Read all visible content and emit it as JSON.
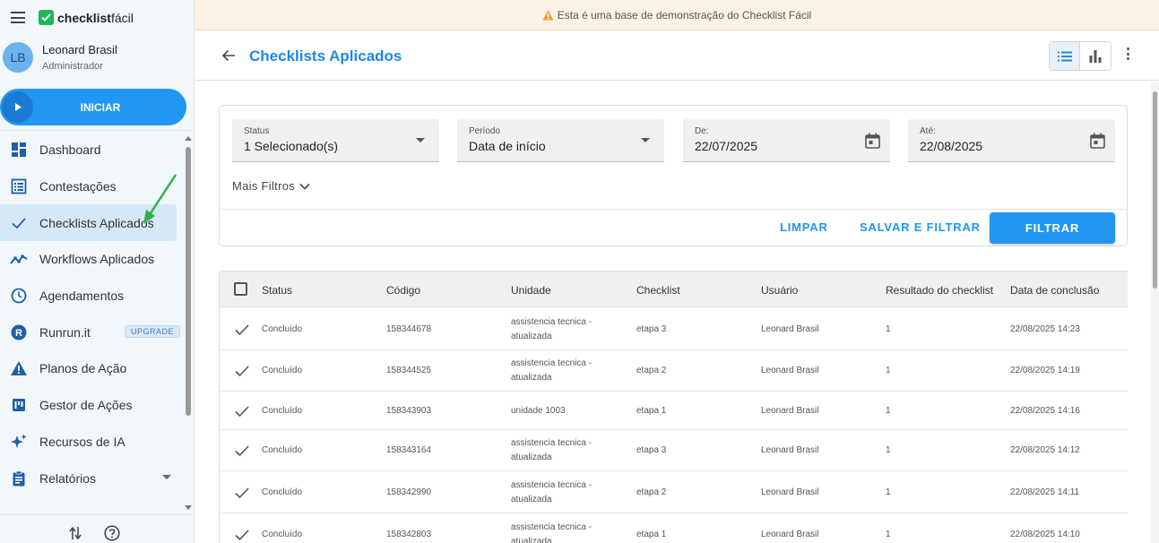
{
  "sidebar": {
    "logo_bold": "checklist",
    "logo_light": "fácil",
    "user_initials": "LB",
    "user_name": "Leonard Brasil",
    "user_role": "Administrador",
    "start_label": "INICIAR",
    "items": [
      {
        "label": "Dashboard",
        "icon": "dashboard-icon"
      },
      {
        "label": "Contestações",
        "icon": "list-icon"
      },
      {
        "label": "Checklists Aplicados",
        "icon": "check-icon"
      },
      {
        "label": "Workflows Aplicados",
        "icon": "trend-icon"
      },
      {
        "label": "Agendamentos",
        "icon": "clock-icon"
      },
      {
        "label": "Runrun.it",
        "icon": "runrun-icon",
        "badge": "UPGRADE"
      },
      {
        "label": "Planos de Ação",
        "icon": "warning-icon"
      },
      {
        "label": "Gestor de Ações",
        "icon": "kanban-icon"
      },
      {
        "label": "Recursos de IA",
        "icon": "sparkle-icon"
      },
      {
        "label": "Relatórios",
        "icon": "report-icon"
      }
    ]
  },
  "banner": {
    "text": "Esta é uma base de demonstração do Checklist Fácil"
  },
  "header": {
    "title": "Checklists Aplicados"
  },
  "filters": {
    "status_label": "Status",
    "status_value": "1 Selecionado(s)",
    "periodo_label": "Período",
    "periodo_value": "Data de início",
    "de_label": "De:",
    "de_value": "22/07/2025",
    "ate_label": "Até:",
    "ate_value": "22/08/2025",
    "more_label": "Mais Filtros",
    "clear_label": "LIMPAR",
    "save_label": "SALVAR E FILTRAR",
    "filter_label": "FILTRAR"
  },
  "table": {
    "headers": [
      "Status",
      "Código",
      "Unidade",
      "Checklist",
      "Usuário",
      "Resultado do checklist",
      "Data de conclusão"
    ],
    "rows": [
      {
        "status": "Concluído",
        "code": "158344678",
        "unit1": "assistencia tecnica -",
        "unit2": "atualizada",
        "checklist": "etapa 3",
        "user": "Leonard Brasil",
        "result": "1",
        "date": "22/08/2025 14:23"
      },
      {
        "status": "Concluído",
        "code": "158344525",
        "unit1": "assistencia tecnica -",
        "unit2": "atualizada",
        "checklist": "etapa 2",
        "user": "Leonard Brasil",
        "result": "1",
        "date": "22/08/2025 14:19"
      },
      {
        "status": "Concluído",
        "code": "158343903",
        "unit1": "unidade 1003",
        "unit2": "",
        "checklist": "etapa 1",
        "user": "Leonard Brasil",
        "result": "1",
        "date": "22/08/2025 14:16"
      },
      {
        "status": "Concluído",
        "code": "158343164",
        "unit1": "assistencia tecnica -",
        "unit2": "atualizada",
        "checklist": "etapa 3",
        "user": "Leonard Brasil",
        "result": "1",
        "date": "22/08/2025 14:12"
      },
      {
        "status": "Concluído",
        "code": "158342990",
        "unit1": "assistencia tecnica -",
        "unit2": "atualizada",
        "checklist": "etapa 2",
        "user": "Leonard Brasil",
        "result": "1",
        "date": "22/08/2025 14:11"
      },
      {
        "status": "Concluído",
        "code": "158342803",
        "unit1": "assistencia tecnica -",
        "unit2": "atualizada",
        "checklist": "etapa 1",
        "user": "Leonard Brasil",
        "result": "1",
        "date": "22/08/2025 14:10"
      }
    ]
  },
  "colors": {
    "accent": "#2196f3",
    "brand_green": "#1db954",
    "banner_bg": "#fdf1e3"
  }
}
